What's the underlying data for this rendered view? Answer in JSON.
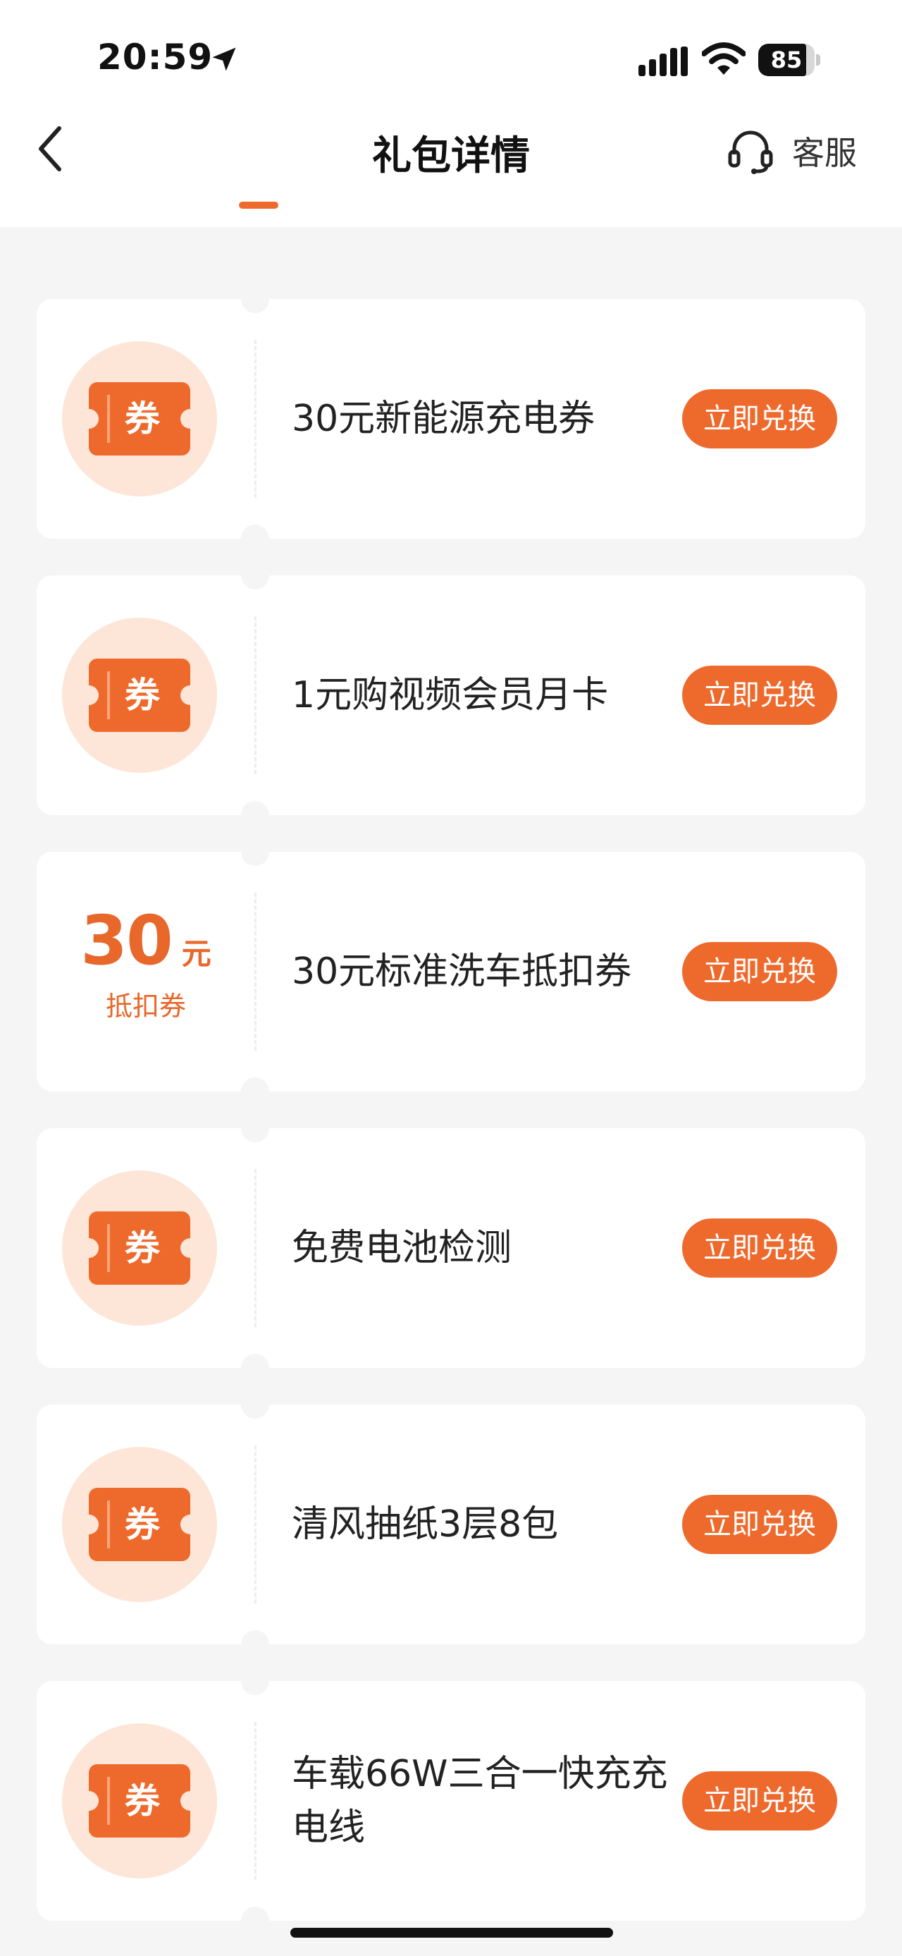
{
  "status_bar": {
    "time": "20:59",
    "battery": "85",
    "battery_level": 0.85
  },
  "nav": {
    "title": "礼包详情",
    "service_label": "客服"
  },
  "coupon_icon_text": "券",
  "redeem_label": "立即兑换",
  "coupons": [
    {
      "title": "30元新能源充电券",
      "kind": "icon"
    },
    {
      "title": "1元购视频会员月卡",
      "kind": "icon"
    },
    {
      "title": "30元标准洗车抵扣券",
      "kind": "amount",
      "amount": "30",
      "unit": "元",
      "desc": "抵扣券"
    },
    {
      "title": "免费电池检测",
      "kind": "icon"
    },
    {
      "title": "清风抽纸3层8包",
      "kind": "icon"
    },
    {
      "title": "车载66W三合一快充充电线",
      "kind": "icon"
    }
  ],
  "colors": {
    "accent": "#ee6a2c",
    "icon_bg": "#fde6d8",
    "page_bg": "#f5f5f5"
  }
}
